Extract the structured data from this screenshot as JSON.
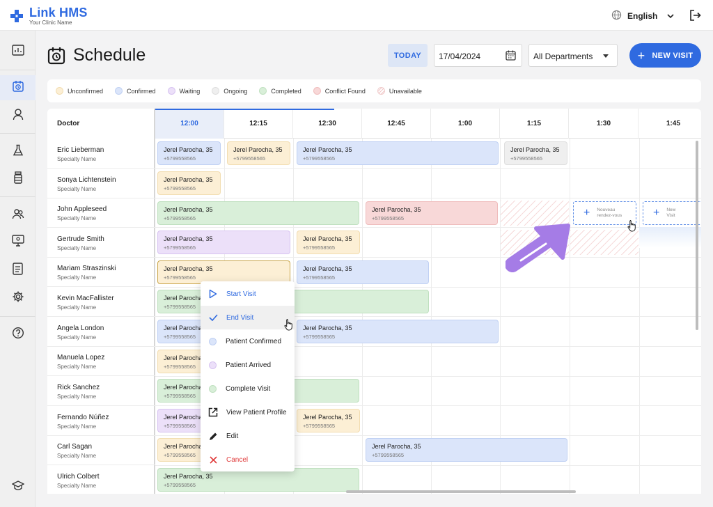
{
  "app": {
    "brand": "Link HMS",
    "clinic": "Your Clinic Name"
  },
  "topbar": {
    "language": "English"
  },
  "sidebar": {
    "items": [
      {
        "icon": "dashboard-icon"
      },
      {
        "icon": "schedule-icon",
        "active": true
      },
      {
        "icon": "user-icon"
      },
      {
        "icon": "lab-flask-icon"
      },
      {
        "icon": "medicine-bottle-icon"
      },
      {
        "icon": "patients-group-icon"
      },
      {
        "icon": "monitor-icon"
      },
      {
        "icon": "report-icon"
      },
      {
        "icon": "settings-icon"
      },
      {
        "icon": "help-icon"
      },
      {
        "icon": "graduation-cap-icon"
      }
    ]
  },
  "header": {
    "title": "Schedule",
    "today_label": "TODAY",
    "date_value": "17/04/2024",
    "department": "All Departments",
    "new_visit_label": "NEW VISIT"
  },
  "legend": [
    {
      "label": "Unconfirmed",
      "color": "#fcefd5"
    },
    {
      "label": "Confirmed",
      "color": "#dbe5fa"
    },
    {
      "label": "Waiting",
      "color": "#ece0f9"
    },
    {
      "label": "Ongoing",
      "color": "#efefef"
    },
    {
      "label": "Completed",
      "color": "#d9efd9"
    },
    {
      "label": "Conflict Found",
      "color": "#f8d8d8"
    },
    {
      "label": "Unavailable",
      "color": "#fbe4e4"
    }
  ],
  "table": {
    "doctor_header": "Doctor",
    "times": [
      "12:00",
      "12:15",
      "12:30",
      "12:45",
      "1:00",
      "1:15",
      "1:30",
      "1:45"
    ],
    "current_time_index": 0,
    "doctors": [
      {
        "name": "Eric Lieberman",
        "specialty": "Specialty Name"
      },
      {
        "name": "Sonya Lichtenstein",
        "specialty": "Specialty Name"
      },
      {
        "name": "John Appleseed",
        "specialty": "Specialty Name"
      },
      {
        "name": "Gertrude Smith",
        "specialty": "Specialty Name"
      },
      {
        "name": "Mariam Straszinski",
        "specialty": "Specialty Name"
      },
      {
        "name": "Kevin MacFallister",
        "specialty": "Specialty Name"
      },
      {
        "name": "Angela London",
        "specialty": "Specialty Name"
      },
      {
        "name": "Manuela Lopez",
        "specialty": "Specialty Name"
      },
      {
        "name": "Rick Sanchez",
        "specialty": "Specialty Name"
      },
      {
        "name": "Fernando Núñez",
        "specialty": "Specialty Name"
      },
      {
        "name": "Carl Sagan",
        "specialty": "Specialty Name"
      },
      {
        "name": "Ulrich Colbert",
        "specialty": "Specialty Name"
      }
    ],
    "patient_name": "Jerel Parocha, 35",
    "patient_name_short": "Jerel Parocha",
    "patient_phone": "+5799558565"
  },
  "new_slots": [
    {
      "line1": "Nouveau",
      "line2": "rendez-vous"
    },
    {
      "line1": "New",
      "line2": "Visit"
    }
  ],
  "menu": {
    "items": [
      {
        "label": "Start Visit"
      },
      {
        "label": "End Visit"
      },
      {
        "label": "Patient Confirmed"
      },
      {
        "label": "Patient Arrived"
      },
      {
        "label": "Complete Visit"
      },
      {
        "label": "View Patient Profile"
      },
      {
        "label": "Edit"
      },
      {
        "label": "Cancel"
      }
    ]
  }
}
